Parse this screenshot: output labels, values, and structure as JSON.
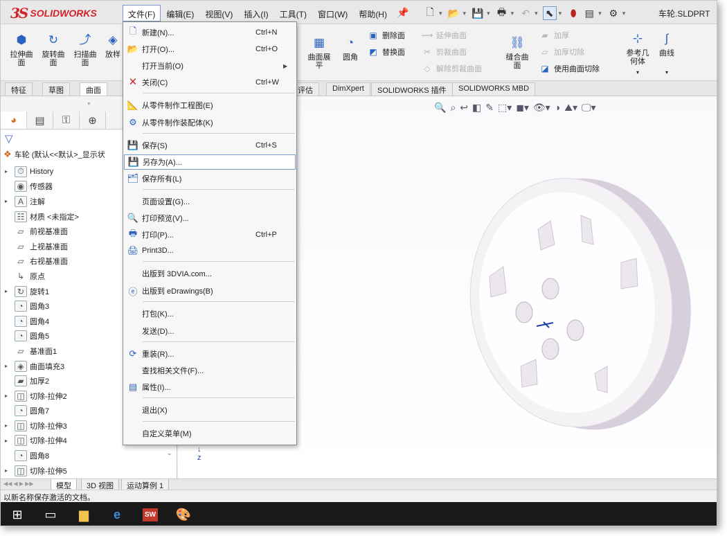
{
  "app": {
    "brand": "SOLIDWORKS",
    "file_name": "车轮.SLDPRT"
  },
  "menubar": {
    "items": [
      {
        "label": "文件(F)"
      },
      {
        "label": "编辑(E)"
      },
      {
        "label": "视图(V)"
      },
      {
        "label": "插入(I)"
      },
      {
        "label": "工具(T)"
      },
      {
        "label": "窗口(W)"
      },
      {
        "label": "帮助(H)"
      }
    ]
  },
  "quick_access": [
    "new-file-icon",
    "open-icon",
    "save-icon",
    "print-icon",
    "undo-icon",
    "select-icon",
    "traffic-light-icon",
    "options-panel-icon",
    "gear-icon"
  ],
  "ribbon": {
    "left_buttons": [
      {
        "label": "拉伸曲\n面",
        "icon": "extrude-surface-icon"
      },
      {
        "label": "旋转曲\n面",
        "icon": "revolve-surface-icon"
      },
      {
        "label": "扫描曲\n面",
        "icon": "sweep-surface-icon"
      },
      {
        "label": "放样",
        "icon": "loft-surface-icon"
      }
    ],
    "mid_buttons": [
      {
        "label": "曲面展\n平",
        "icon": "flatten-surface-icon"
      },
      {
        "label": "圆角",
        "icon": "fillet-icon"
      }
    ],
    "mid_small": [
      {
        "label": "删除面",
        "icon": "delete-face-icon",
        "disabled": false
      },
      {
        "label": "替换面",
        "icon": "replace-face-icon",
        "disabled": false
      }
    ],
    "right_small": [
      {
        "label": "延伸曲面",
        "icon": "extend-surface-icon",
        "disabled": true
      },
      {
        "label": "剪裁曲面",
        "icon": "trim-surface-icon",
        "disabled": true
      },
      {
        "label": "解除剪裁曲面",
        "icon": "untrim-surface-icon",
        "disabled": true
      }
    ],
    "knit_button": {
      "label": "缝合曲\n面",
      "icon": "knit-surface-icon"
    },
    "thicken_small": [
      {
        "label": "加厚",
        "icon": "thicken-icon",
        "disabled": true
      },
      {
        "label": "加厚切除",
        "icon": "thicken-cut-icon",
        "disabled": true
      },
      {
        "label": "使用曲面切除",
        "icon": "surface-cut-icon",
        "disabled": false
      }
    ],
    "ref_button": {
      "label": "参考几\n何体",
      "icon": "reference-geometry-icon"
    },
    "curve_button": {
      "label": "曲线",
      "icon": "curves-icon"
    }
  },
  "command_tabs": [
    {
      "label": "特征"
    },
    {
      "label": "草图"
    },
    {
      "label": "曲面"
    },
    {
      "label": "评估"
    },
    {
      "label": "DimXpert"
    },
    {
      "label": "SOLIDWORKS 插件"
    },
    {
      "label": "SOLIDWORKS MBD"
    }
  ],
  "feature_tree": {
    "root": "车轮 (默认<<默认>_显示状",
    "items": [
      {
        "label": "History",
        "arrow": true,
        "icon": "history-icon"
      },
      {
        "label": "传感器",
        "arrow": false,
        "icon": "sensor-icon"
      },
      {
        "label": "注解",
        "arrow": true,
        "icon": "annotation-icon"
      },
      {
        "label": "材质 <未指定>",
        "arrow": false,
        "icon": "material-icon"
      },
      {
        "label": "前视基准面",
        "arrow": false,
        "icon": "plane-icon"
      },
      {
        "label": "上视基准面",
        "arrow": false,
        "icon": "plane-icon"
      },
      {
        "label": "右视基准面",
        "arrow": false,
        "icon": "plane-icon"
      },
      {
        "label": "原点",
        "arrow": false,
        "icon": "origin-icon"
      },
      {
        "label": "旋转1",
        "arrow": true,
        "icon": "revolve-feature-icon"
      },
      {
        "label": "圆角3",
        "arrow": false,
        "icon": "fillet-feature-icon"
      },
      {
        "label": "圆角4",
        "arrow": false,
        "icon": "fillet-feature-icon"
      },
      {
        "label": "圆角5",
        "arrow": false,
        "icon": "fillet-feature-icon"
      },
      {
        "label": "基准面1",
        "arrow": false,
        "icon": "plane-icon"
      },
      {
        "label": "曲面填充3",
        "arrow": true,
        "icon": "fill-surface-icon"
      },
      {
        "label": "加厚2",
        "arrow": false,
        "icon": "thicken-feature-icon"
      },
      {
        "label": "切除-拉伸2",
        "arrow": true,
        "icon": "cut-extrude-icon"
      },
      {
        "label": "圆角7",
        "arrow": false,
        "icon": "fillet-feature-icon"
      },
      {
        "label": "切除-拉伸3",
        "arrow": true,
        "icon": "cut-extrude-icon"
      },
      {
        "label": "切除-拉伸4",
        "arrow": true,
        "icon": "cut-extrude-icon"
      },
      {
        "label": "圆角8",
        "arrow": false,
        "icon": "fillet-feature-icon"
      },
      {
        "label": "切除-拉伸5",
        "arrow": true,
        "icon": "cut-extrude-icon"
      }
    ]
  },
  "bottom_tabs": [
    {
      "label": "模型"
    },
    {
      "label": "3D 视图"
    },
    {
      "label": "运动算例 1"
    }
  ],
  "status_text": "以新名称保存激活的文档。",
  "file_menu": {
    "items": [
      {
        "label": "新建(N)...",
        "shortcut": "Ctrl+N",
        "icon": "new-file-icon"
      },
      {
        "label": "打开(O)...",
        "shortcut": "Ctrl+O",
        "icon": "open-icon"
      },
      {
        "label": "打开当前(O)",
        "shortcut": "",
        "icon": "",
        "submenu": true
      },
      {
        "label": "关闭(C)",
        "shortcut": "Ctrl+W",
        "icon": "close-doc-icon"
      },
      {
        "label": "从零件制作工程图(E)",
        "shortcut": "",
        "icon": "make-drawing-icon"
      },
      {
        "label": "从零件制作装配体(K)",
        "shortcut": "",
        "icon": "make-assembly-icon"
      },
      {
        "label": "保存(S)",
        "shortcut": "Ctrl+S",
        "icon": "save-icon"
      },
      {
        "label": "另存为(A)...",
        "shortcut": "",
        "icon": "save-as-icon"
      },
      {
        "label": "保存所有(L)",
        "shortcut": "",
        "icon": "save-all-icon"
      },
      {
        "label": "页面设置(G)...",
        "shortcut": "",
        "icon": ""
      },
      {
        "label": "打印预览(V)...",
        "shortcut": "",
        "icon": "print-preview-icon"
      },
      {
        "label": "打印(P)...",
        "shortcut": "Ctrl+P",
        "icon": "print-icon"
      },
      {
        "label": "Print3D...",
        "shortcut": "",
        "icon": "print3d-icon"
      },
      {
        "label": "出版到 3DVIA.com...",
        "shortcut": "",
        "icon": ""
      },
      {
        "label": "出版到 eDrawings(B)",
        "shortcut": "",
        "icon": "edrawings-icon"
      },
      {
        "label": "打包(K)...",
        "shortcut": "",
        "icon": ""
      },
      {
        "label": "发送(D)...",
        "shortcut": "",
        "icon": ""
      },
      {
        "label": "重装(R)...",
        "shortcut": "",
        "icon": "reload-icon"
      },
      {
        "label": "查找相关文件(F)...",
        "shortcut": "",
        "icon": ""
      },
      {
        "label": "属性(I)...",
        "shortcut": "",
        "icon": "properties-icon"
      },
      {
        "label": "退出(X)",
        "shortcut": "",
        "icon": ""
      },
      {
        "label": "自定义菜单(M)",
        "shortcut": "",
        "icon": ""
      }
    ],
    "highlighted_index": 7
  },
  "taskbar": [
    "windows-start-icon",
    "task-view-icon",
    "file-explorer-icon",
    "edge-icon",
    "solidworks-2016-icon",
    "paint-icon"
  ],
  "colors": {
    "brand_red": "#d2232a",
    "accent_blue": "#2a62c2",
    "part_color": "#e9e3ea"
  }
}
